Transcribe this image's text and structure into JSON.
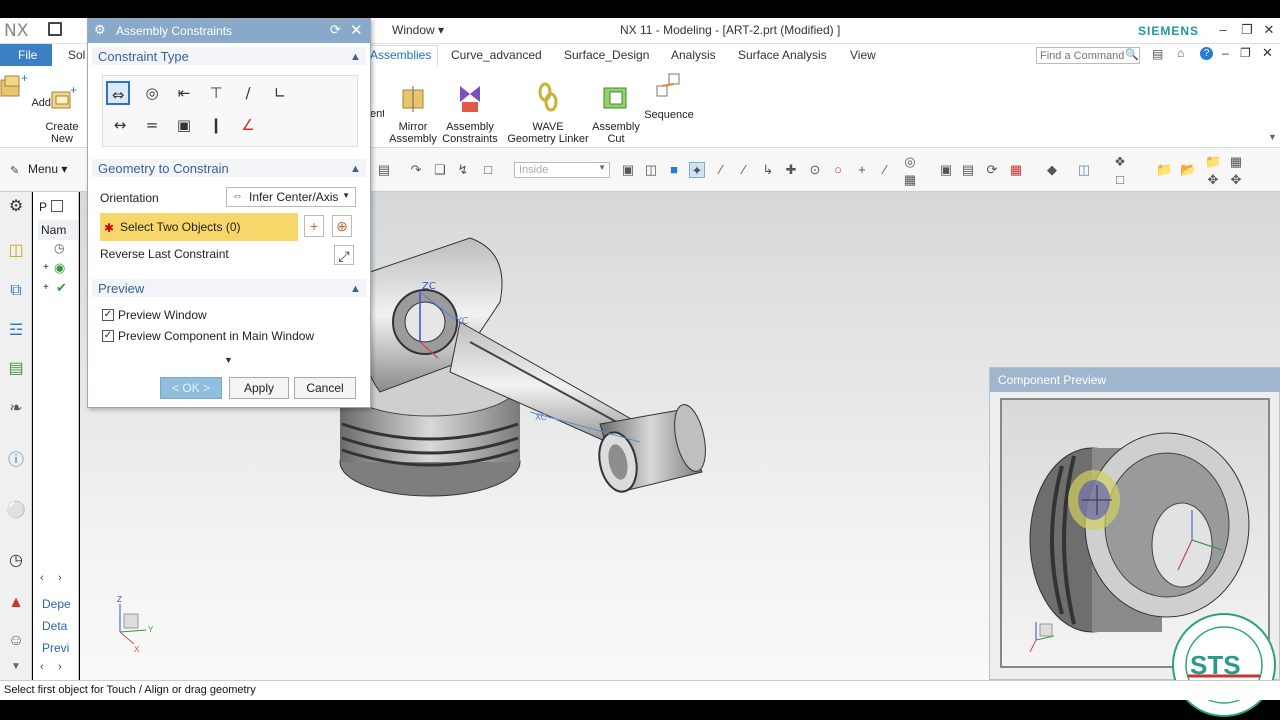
{
  "app": {
    "logo": "NX",
    "window_menu": "Window ▾",
    "title": "NX 11 - Modeling - [ART-2.prt (Modified) ]",
    "brand": "SIEMENS",
    "brand_color": "#1a9aa0"
  },
  "tabs": {
    "file": "File",
    "sol": "Sol",
    "assemblies": "Assemblies",
    "items": [
      "Curve_advanced",
      "Surface_Design",
      "Analysis",
      "Surface Analysis",
      "View"
    ],
    "find_placeholder": "Find a Command"
  },
  "ribbon": {
    "add": "Add",
    "create_new": "Create\nNew",
    "ent": "ent",
    "mirror_assembly": "Mirror\nAssembly",
    "assembly_constraints": "Assembly\nConstraints",
    "wave": "WAVE\nGeometry Linker",
    "assembly_cut": "Assembly\nCut",
    "sequence": "Sequence"
  },
  "toolbar": {
    "menu": "Menu ▾",
    "filter_value": "Inside"
  },
  "nav": {
    "p": "P",
    "nam": "Nam",
    "depe": "Depe",
    "deta": "Deta",
    "previ": "Previ"
  },
  "dialog": {
    "title": "Assembly Constraints",
    "constraint_type": "Constraint Type",
    "geometry_to_constrain": "Geometry to Constrain",
    "orientation_label": "Orientation",
    "orientation_value": "Infer Center/Axis",
    "select_two_objects": "Select Two Objects (0)",
    "reverse_last": "Reverse Last Constraint",
    "preview": "Preview",
    "preview_window": "Preview Window",
    "preview_component": "Preview Component in Main Window",
    "ok": "< OK >",
    "apply": "Apply",
    "cancel": "Cancel"
  },
  "viewport": {
    "zc": "ZC",
    "yc": "YC",
    "xc": "XC"
  },
  "component_preview": {
    "title": "Component Preview"
  },
  "status": {
    "message": "Select first object for Touch / Align or drag geometry"
  }
}
